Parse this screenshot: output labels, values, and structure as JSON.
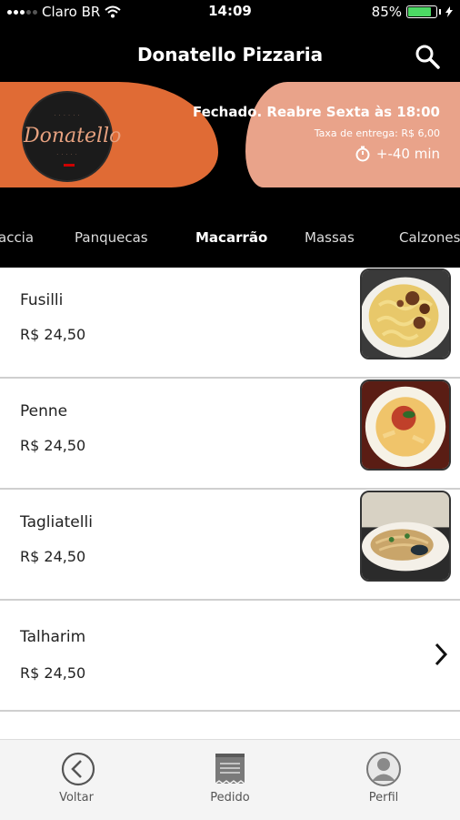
{
  "status_bar": {
    "carrier": "Claro BR",
    "time": "14:09",
    "battery": "85%",
    "battery_level": 0.85
  },
  "header": {
    "title": "Donatello Pizzaria",
    "search_icon": "search-icon"
  },
  "banner": {
    "logo_text": "Donatello",
    "status": "Fechado. Reabre Sexta às 18:00",
    "delivery_fee": "Taxa de entrega: R$ 6,00",
    "eta": "+-40 min"
  },
  "categories": [
    "accia",
    "Panquecas",
    "Macarrão",
    "Massas",
    "Calzones"
  ],
  "active_category": "Macarrão",
  "items": [
    {
      "name": "Fusilli",
      "price": "R$ 24,50",
      "image": "fusilli-photo"
    },
    {
      "name": "Penne",
      "price": "R$ 24,50",
      "image": "penne-photo"
    },
    {
      "name": "Tagliatelli",
      "price": "R$ 24,50",
      "image": "tagliatelli-photo"
    },
    {
      "name": "Talharim",
      "price": "R$ 24,50"
    }
  ],
  "tabbar": {
    "back": "Voltar",
    "order": "Pedido",
    "profile": "Perfil"
  },
  "colors": {
    "orange": "#e06b35",
    "salmon": "#e9a38a",
    "accent_text": "#e7a17f"
  }
}
